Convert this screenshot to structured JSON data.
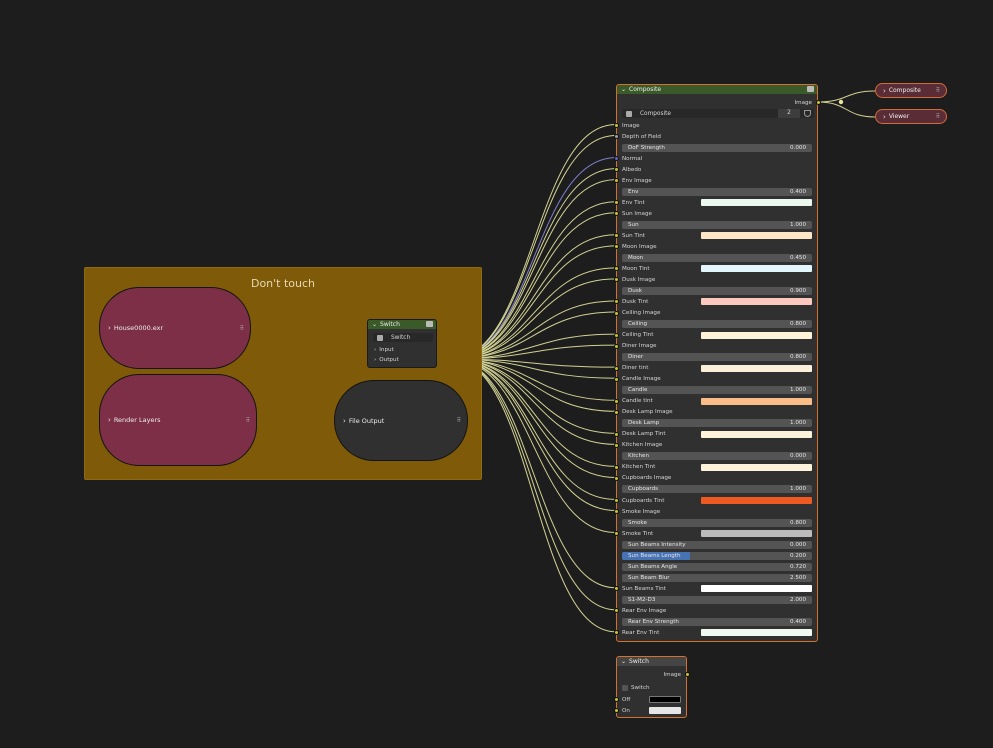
{
  "frame": {
    "label": "Don't touch"
  },
  "nodes": {
    "house": {
      "label": "House0000.exr"
    },
    "render_layers": {
      "label": "Render Layers"
    },
    "file_output": {
      "label": "File Output"
    },
    "switch_group": {
      "title": "Switch",
      "selector_value": "Switch",
      "inputs": [
        "Input",
        "Output"
      ]
    },
    "composite_out": {
      "label": "Composite"
    },
    "viewer": {
      "label": "Viewer"
    },
    "composite": {
      "title": "Composite",
      "output_label": "Image",
      "group_name": "Composite",
      "user_count": "2",
      "rows": [
        {
          "kind": "socket",
          "label": "Image",
          "sock": "yellow"
        },
        {
          "kind": "socket",
          "label": "Depth of Field",
          "sock": "gray"
        },
        {
          "kind": "value",
          "label": "DoF Strength",
          "value": "0.000"
        },
        {
          "kind": "socket",
          "label": "Normal",
          "sock": "blue"
        },
        {
          "kind": "socket",
          "label": "Albedo",
          "sock": "yellow"
        },
        {
          "kind": "socket",
          "label": "Env Image",
          "sock": "yellow"
        },
        {
          "kind": "value",
          "label": "Env",
          "value": "0.400"
        },
        {
          "kind": "color",
          "label": "Env Tint",
          "color": "#eaf8ee"
        },
        {
          "kind": "socket",
          "label": "Sun Image",
          "sock": "yellow"
        },
        {
          "kind": "value",
          "label": "Sun",
          "value": "1.000"
        },
        {
          "kind": "color",
          "label": "Sun Tint",
          "color": "#fde6c6"
        },
        {
          "kind": "socket",
          "label": "Moon Image",
          "sock": "yellow"
        },
        {
          "kind": "value",
          "label": "Moon",
          "value": "0.450"
        },
        {
          "kind": "color",
          "label": "Moon Tint",
          "color": "#e2f6fb"
        },
        {
          "kind": "socket",
          "label": "Dusk Image",
          "sock": "yellow"
        },
        {
          "kind": "value",
          "label": "Dusk",
          "value": "0.900"
        },
        {
          "kind": "color",
          "label": "Dusk Tint",
          "color": "#fcc8c0"
        },
        {
          "kind": "socket",
          "label": "Ceiling Image",
          "sock": "yellow"
        },
        {
          "kind": "value",
          "label": "Ceiling",
          "value": "0.800"
        },
        {
          "kind": "color",
          "label": "Ceiling Tint",
          "color": "#fdf2d8"
        },
        {
          "kind": "socket",
          "label": "Diner Image",
          "sock": "yellow"
        },
        {
          "kind": "value",
          "label": "Diner",
          "value": "0.800"
        },
        {
          "kind": "color",
          "label": "Diner tint",
          "color": "#fdf0da"
        },
        {
          "kind": "socket",
          "label": "Candle Image",
          "sock": "yellow"
        },
        {
          "kind": "value",
          "label": "Candle",
          "value": "1.000"
        },
        {
          "kind": "color",
          "label": "Candle tint",
          "color": "#fbbd87"
        },
        {
          "kind": "socket",
          "label": "Desk Lamp Image",
          "sock": "yellow"
        },
        {
          "kind": "value",
          "label": "Desk Lamp",
          "value": "1.000"
        },
        {
          "kind": "color",
          "label": "Desk Lamp Tint",
          "color": "#fdf3da"
        },
        {
          "kind": "socket",
          "label": "Kitchen Image",
          "sock": "yellow"
        },
        {
          "kind": "value",
          "label": "Kitchen",
          "value": "0.000"
        },
        {
          "kind": "color",
          "label": "Kitchen Tint",
          "color": "#fdf3da"
        },
        {
          "kind": "socket",
          "label": "Cupboards Image",
          "sock": "yellow"
        },
        {
          "kind": "value",
          "label": "Cupboards",
          "value": "1.000"
        },
        {
          "kind": "color",
          "label": "Cupboards Tint",
          "color": "#ee5a22"
        },
        {
          "kind": "socket",
          "label": "Smoke Image",
          "sock": "yellow"
        },
        {
          "kind": "value",
          "label": "Smoke",
          "value": "0.800"
        },
        {
          "kind": "color",
          "label": "Smoke Tint",
          "color": "#bcbcbc"
        },
        {
          "kind": "value",
          "label": "Sun Beams Intensity",
          "value": "0.000"
        },
        {
          "kind": "value",
          "label": "Sun Beams Length",
          "value": "0.200",
          "highlight": true
        },
        {
          "kind": "value",
          "label": "Sun Beams Angle",
          "value": "0.720"
        },
        {
          "kind": "value",
          "label": "Sun Beam Blur",
          "value": "2.500"
        },
        {
          "kind": "color",
          "label": "Sun Beams Tint",
          "color": "#ffffff"
        },
        {
          "kind": "value",
          "label": "S1-M2-D3",
          "value": "2.000"
        },
        {
          "kind": "socket",
          "label": "Rear Env Image",
          "sock": "yellow"
        },
        {
          "kind": "value",
          "label": "Rear Env Strength",
          "value": "0.400"
        },
        {
          "kind": "color",
          "label": "Rear Env Tint",
          "color": "#effaf1"
        }
      ]
    },
    "switch_small": {
      "title": "Switch",
      "output_label": "Image",
      "checkbox_label": "Switch",
      "off_label": "Off",
      "on_label": "On",
      "off_color": "#000000",
      "on_color": "#e6e6e6"
    }
  },
  "colors": {
    "accent": "#d6702e",
    "image_socket": "#c7c729",
    "vector_socket": "#6363c7",
    "frame": "#7f5a09"
  }
}
